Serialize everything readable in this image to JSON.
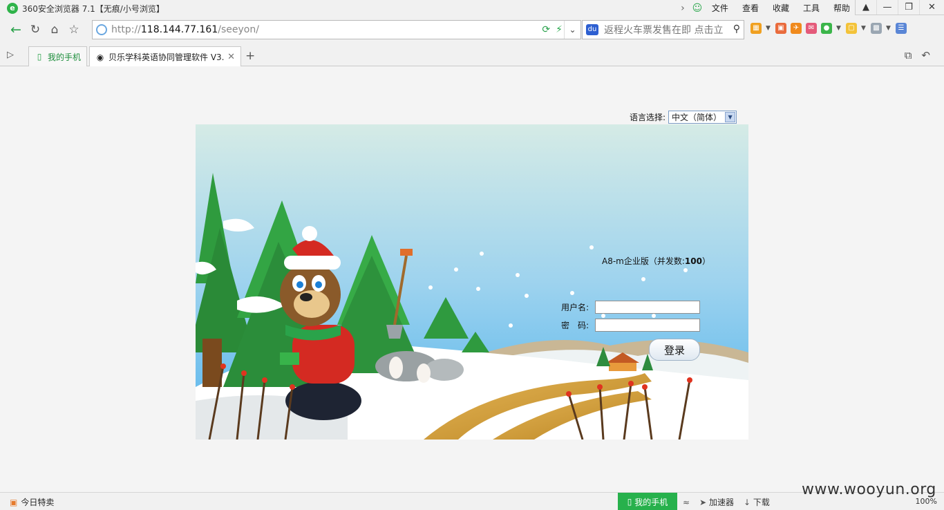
{
  "titlebar": {
    "app_logo": "e",
    "title": "360安全浏览器 7.1【无痕/小号浏览】",
    "menu": [
      "文件",
      "查看",
      "收藏",
      "工具",
      "帮助"
    ]
  },
  "navbar": {
    "url_prefix": "http://",
    "url_host": "118.144.77.161",
    "url_path": "/seeyon/",
    "search_placeholder": "返程火车票发售在即 点击立",
    "search_engine": "du"
  },
  "tabs": {
    "phone_tab": "我的手机",
    "active_tab": "贝乐学科英语协同管理软件 V3."
  },
  "login": {
    "language_label": "语言选择:",
    "language_value": "中文（简体）",
    "edition_text": "A8-m企业版（并发数:",
    "edition_count": "100",
    "edition_close": "）",
    "username_label": "用户名:",
    "password_label": "密　码:",
    "login_button": "登录"
  },
  "statusbar": {
    "today_deals": "今日特卖",
    "my_phone": "我的手机",
    "accelerator": "加速器",
    "download": "下载",
    "zoom": "100%"
  },
  "watermark": "www.wooyun.org",
  "colors": {
    "accent_green": "#27b14c",
    "sky_top": "#d5ebe6",
    "sky_bottom": "#52b3ec"
  }
}
